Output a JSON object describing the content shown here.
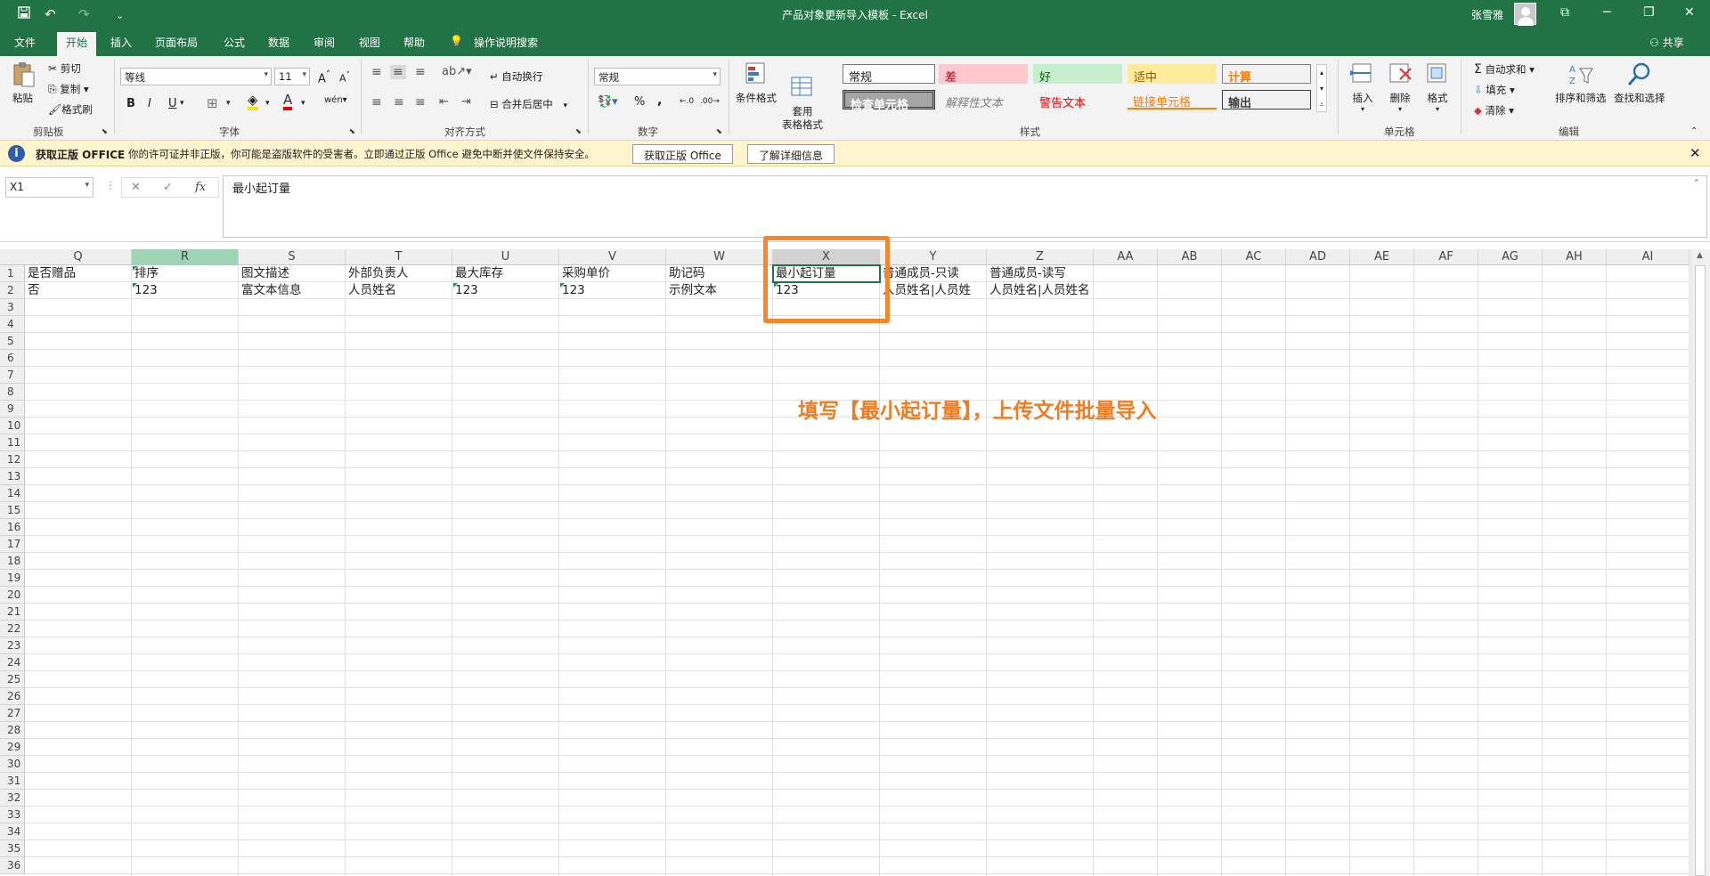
{
  "titlebar": {
    "title": "产品对象更新导入模板  -  Excel",
    "user": "张雪雅",
    "qa_save_icon": "save-icon",
    "qa_undo": "↶",
    "qa_redo": "↷",
    "qa_more": "⌄"
  },
  "tabs": [
    "文件",
    "开始",
    "插入",
    "页面布局",
    "公式",
    "数据",
    "审阅",
    "视图",
    "帮助"
  ],
  "tell_me": "操作说明搜索",
  "share": "共享",
  "ribbon": {
    "clipboard": {
      "paste": "粘贴",
      "cut": "剪切",
      "copy": "复制",
      "format_painter": "格式刷",
      "label": "剪贴板"
    },
    "font": {
      "name": "等线",
      "size": "11",
      "bold": "B",
      "italic": "I",
      "underline": "U",
      "label": "字体"
    },
    "align": {
      "wrap": "自动换行",
      "merge": "合并后居中",
      "label": "对齐方式"
    },
    "number": {
      "format": "常规",
      "percent": "%",
      "comma": ",",
      "label": "数字"
    },
    "styles": {
      "cond": "条件格式",
      "table": "套用\n表格格式",
      "cells": [
        "常规",
        "差",
        "好",
        "适中",
        "计算",
        "检查单元格",
        "解释性文本",
        "警告文本",
        "链接单元格",
        "输出"
      ],
      "label": "样式"
    },
    "cells": {
      "insert": "插入",
      "delete": "删除",
      "format": "格式",
      "label": "单元格"
    },
    "editing": {
      "autosum": "自动求和",
      "fill": "填充",
      "clear": "清除",
      "sort": "排序和筛选",
      "find": "查找和选择",
      "label": "编辑"
    }
  },
  "notice": {
    "title": "获取正版 OFFICE",
    "message": "你的许可证并非正版，你可能是盗版软件的受害者。立即通过正版 Office 避免中断并使文件保持安全。",
    "btn1": "获取正版 Office",
    "btn2": "了解详细信息"
  },
  "formula_bar": {
    "name_box": "X1",
    "cancel": "✕",
    "enter": "✓",
    "fx": "fx",
    "content": "最小起订量"
  },
  "grid": {
    "columns": [
      "Q",
      "R",
      "S",
      "T",
      "U",
      "V",
      "W",
      "X",
      "Y",
      "Z",
      "AA",
      "AB",
      "AC",
      "AD",
      "AE",
      "AF",
      "AG",
      "AH",
      "AI"
    ],
    "rows": [
      "1",
      "2",
      "3",
      "4",
      "5",
      "6",
      "7",
      "8",
      "9",
      "10",
      "11",
      "12",
      "13",
      "14",
      "15",
      "16",
      "17",
      "18",
      "19",
      "20",
      "21",
      "22",
      "23",
      "24",
      "25",
      "26",
      "27",
      "28",
      "29",
      "30",
      "31",
      "32",
      "33",
      "34",
      "35",
      "36"
    ],
    "row1": [
      "是否赠品",
      "排序",
      "图文描述",
      "外部负责人",
      "最大库存",
      "采购单价",
      "助记码",
      "最小起订量",
      "普通成员-只读",
      "普通成员-读写"
    ],
    "row2": [
      "否",
      "123",
      "富文本信息",
      "人员姓名",
      "123",
      "123",
      "示例文本",
      "123",
      "人员姓名|人员姓",
      "人员姓名|人员姓名"
    ]
  },
  "annotation": "填写【最小起订量】，上传文件批量导入",
  "colors": {
    "excel_green": "#217346",
    "annotation_orange": "#f07c21"
  }
}
